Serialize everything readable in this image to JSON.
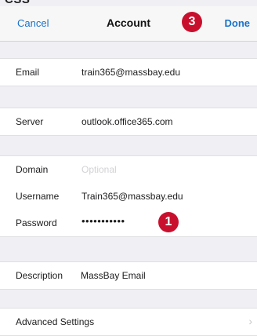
{
  "top_fragment": "CSS",
  "navbar": {
    "cancel_label": "Cancel",
    "title": "Account",
    "done_label": "Done",
    "badge_3": "3"
  },
  "account": {
    "email_label": "Email",
    "email_value": "train365@massbay.edu",
    "server_label": "Server",
    "server_value": "outlook.office365.com",
    "domain_label": "Domain",
    "domain_placeholder": "Optional",
    "username_label": "Username",
    "username_value": "Train365@massbay.edu",
    "password_label": "Password",
    "password_value": "•••••••••••",
    "badge_1": "1",
    "description_label": "Description",
    "description_value": "MassBay Email",
    "advanced_label": "Advanced Settings"
  },
  "colors": {
    "accent": "#1a73c8",
    "badge": "#c8102e"
  }
}
